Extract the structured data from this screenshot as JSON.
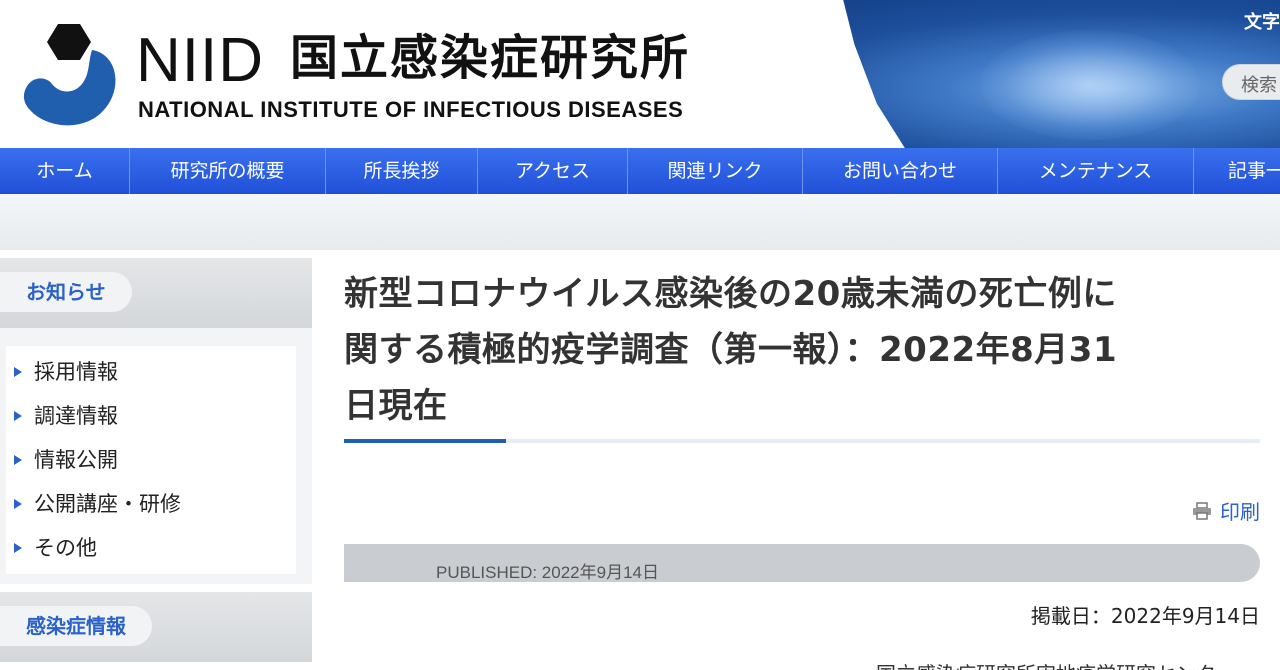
{
  "header": {
    "logo_text": "NIID",
    "logo_jp": "国立感染症研究所",
    "logo_en": "NATIONAL INSTITUTE OF INFECTIOUS DISEASES",
    "lang_link": "文字",
    "search_placeholder": "検索"
  },
  "nav": {
    "items": [
      {
        "label": "ホーム"
      },
      {
        "label": "研究所の概要"
      },
      {
        "label": "所長挨拶"
      },
      {
        "label": "アクセス"
      },
      {
        "label": "関連リンク"
      },
      {
        "label": "お問い合わせ"
      },
      {
        "label": "メンテナンス"
      },
      {
        "label": "記事一"
      }
    ]
  },
  "sidebar": {
    "section1_title": "お知らせ",
    "items": [
      {
        "label": "採用情報"
      },
      {
        "label": "調達情報"
      },
      {
        "label": "情報公開"
      },
      {
        "label": "公開講座・研修"
      },
      {
        "label": "その他"
      }
    ],
    "section2_title": "感染症情報"
  },
  "article": {
    "title_line1": "新型コロナウイルス感染後の20歳未満の死亡例に",
    "title_line2": "関する積極的疫学調査（第一報）：2022年8月31",
    "title_line3": "日現在",
    "print_label": "印刷",
    "published": "PUBLISHED: 2022年9月14日",
    "posted_date": "掲載日：2022年9月14日",
    "author_partial": "国立感染症研究所実地疫学研究センター"
  },
  "colors": {
    "nav_blue": "#2b5fe3",
    "accent_blue": "#2a62c8",
    "logo_blue": "#1f5fae"
  }
}
